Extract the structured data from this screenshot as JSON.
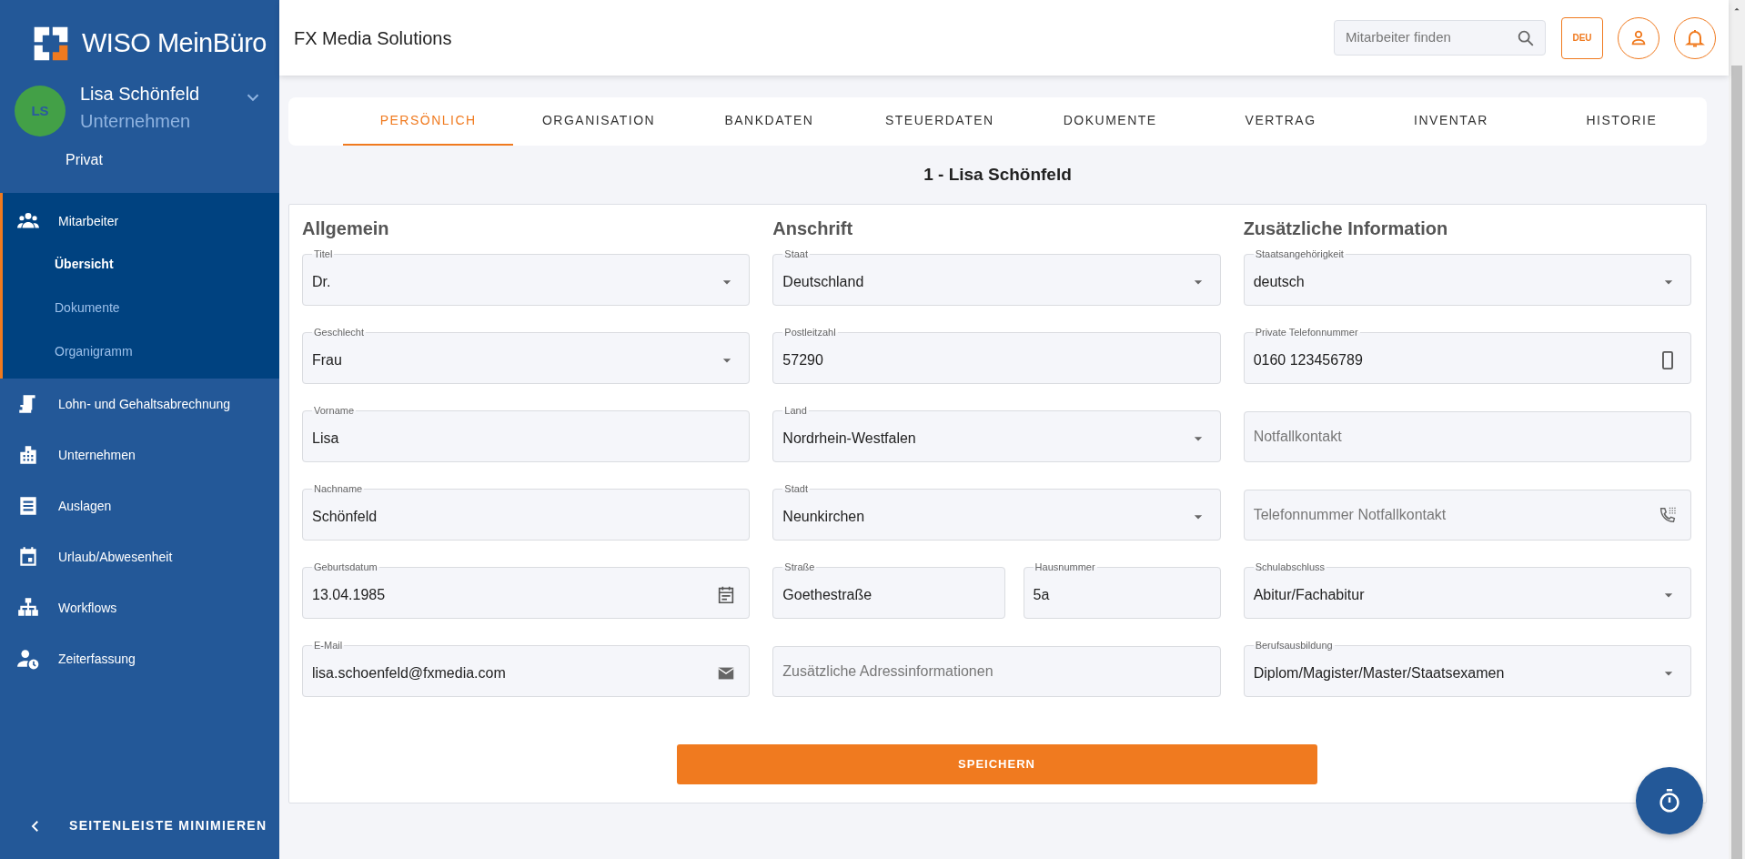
{
  "sidebar": {
    "logo_text": "WISO MeinBüro",
    "user": {
      "initials": "LS",
      "name": "Lisa Schönfeld",
      "context": "Unternehmen",
      "options": [
        "Privat"
      ]
    },
    "nav": [
      {
        "label": "Mitarbeiter",
        "expanded": true,
        "children": [
          {
            "label": "Übersicht",
            "selected": true
          },
          {
            "label": "Dokumente",
            "selected": false
          },
          {
            "label": "Organigramm",
            "selected": false
          }
        ]
      },
      {
        "label": "Lohn- und Gehaltsabrechnung"
      },
      {
        "label": "Unternehmen"
      },
      {
        "label": "Auslagen"
      },
      {
        "label": "Urlaub/Abwesenheit"
      },
      {
        "label": "Workflows"
      },
      {
        "label": "Zeiterfassung"
      }
    ],
    "minimize_label": "SEITENLEISTE MINIMIEREN"
  },
  "header": {
    "title": "FX Media Solutions",
    "search": {
      "placeholder": "Mitarbeiter finden"
    },
    "language": "DEU"
  },
  "tabs": [
    {
      "label": "PERSÖNLICH",
      "selected": true
    },
    {
      "label": "ORGANISATION",
      "selected": false
    },
    {
      "label": "BANKDATEN",
      "selected": false
    },
    {
      "label": "STEUERDATEN",
      "selected": false
    },
    {
      "label": "DOKUMENTE",
      "selected": false
    },
    {
      "label": "VERTRAG",
      "selected": false
    },
    {
      "label": "INVENTAR",
      "selected": false
    },
    {
      "label": "HISTORIE",
      "selected": false
    }
  ],
  "employee_title": "1 - Lisa Schönfeld",
  "form": {
    "sections": [
      {
        "heading": "Allgemein",
        "rows": [
          [
            {
              "kind": "select",
              "label": "Titel",
              "value": "Dr."
            }
          ],
          [
            {
              "kind": "select",
              "label": "Geschlecht",
              "value": "Frau"
            }
          ],
          [
            {
              "kind": "text",
              "label": "Vorname",
              "value": "Lisa"
            }
          ],
          [
            {
              "kind": "text",
              "label": "Nachname",
              "value": "Schönfeld"
            }
          ],
          [
            {
              "kind": "date",
              "label": "Geburtsdatum",
              "value": "13.04.1985"
            }
          ],
          [
            {
              "kind": "email",
              "label": "E-Mail",
              "value": "lisa.schoenfeld@fxmedia.com"
            }
          ]
        ]
      },
      {
        "heading": "Anschrift",
        "rows": [
          [
            {
              "kind": "select",
              "label": "Staat",
              "value": "Deutschland"
            }
          ],
          [
            {
              "kind": "text",
              "label": "Postleitzahl",
              "value": "57290"
            }
          ],
          [
            {
              "kind": "select",
              "label": "Land",
              "value": "Nordrhein-Westfalen"
            }
          ],
          [
            {
              "kind": "select",
              "label": "Stadt",
              "value": "Neunkirchen"
            }
          ],
          [
            {
              "kind": "text",
              "label": "Straße",
              "value": "Goethestraße"
            },
            {
              "kind": "text",
              "label": "Hausnummer",
              "value": "5a"
            }
          ],
          [
            {
              "kind": "text",
              "placeholder": "Zusätzliche Adressinformationen"
            }
          ]
        ]
      },
      {
        "heading": "Zusätzliche Information",
        "rows": [
          [
            {
              "kind": "select",
              "label": "Staatsangehörigkeit",
              "value": "deutsch"
            }
          ],
          [
            {
              "kind": "mobile",
              "label": "Private Telefonnummer",
              "value": "0160 123456789"
            }
          ],
          [
            {
              "kind": "text",
              "placeholder": "Notfallkontakt"
            }
          ],
          [
            {
              "kind": "phone",
              "placeholder": "Telefonnummer Notfallkontakt"
            }
          ],
          [
            {
              "kind": "select",
              "label": "Schulabschluss",
              "value": "Abitur/Fachabitur"
            }
          ],
          [
            {
              "kind": "select",
              "label": "Berufsausbildung",
              "value": "Diplom/Magister/Master/Staatsexamen"
            }
          ]
        ]
      }
    ]
  },
  "save_button": "SPEICHERN"
}
